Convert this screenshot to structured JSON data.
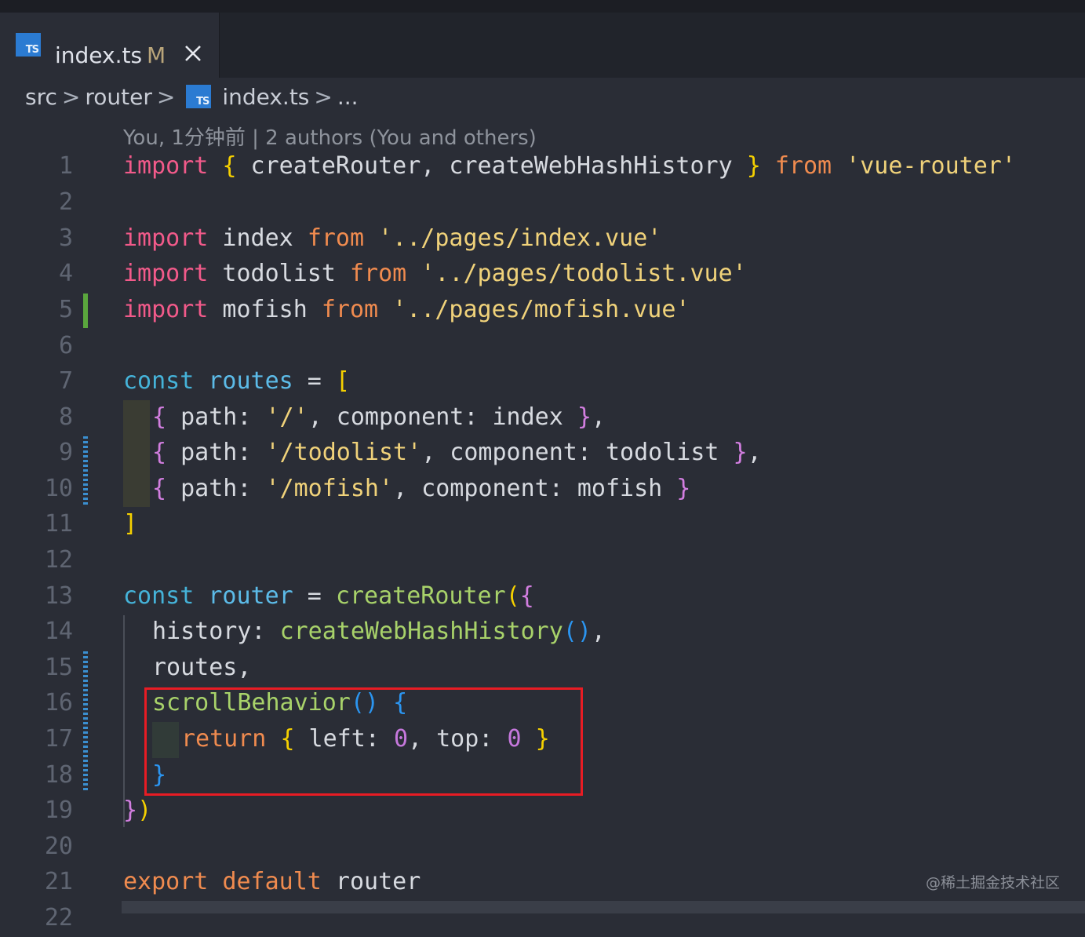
{
  "tab": {
    "icon_label": "TS",
    "title": "index.ts",
    "modified_badge": "M",
    "close_icon": "close-icon"
  },
  "breadcrumb": {
    "items": [
      "src",
      "router",
      "index.ts",
      "..."
    ],
    "separator": ">"
  },
  "blame": "You, 1分钟前 | 2 authors (You and others)",
  "line_numbers": [
    "1",
    "2",
    "3",
    "4",
    "5",
    "6",
    "7",
    "8",
    "9",
    "10",
    "11",
    "12",
    "13",
    "14",
    "15",
    "16",
    "17",
    "18",
    "19",
    "20",
    "21",
    "22"
  ],
  "code": {
    "l1": [
      "import",
      " ",
      "{",
      " createRouter, createWebHashHistory ",
      "}",
      " ",
      "from",
      " ",
      "'vue-router'"
    ],
    "l3": [
      "import",
      " index ",
      "from",
      " ",
      "'../pages/index.vue'"
    ],
    "l4": [
      "import",
      " todolist ",
      "from",
      " ",
      "'../pages/todolist.vue'"
    ],
    "l5": [
      "import",
      " mofish ",
      "from",
      " ",
      "'../pages/mofish.vue'"
    ],
    "l7": [
      "const",
      " ",
      "routes",
      " = ",
      "["
    ],
    "l8": [
      "{",
      " path: ",
      "'/'",
      ", component: index ",
      "}",
      ","
    ],
    "l9": [
      "{",
      " path: ",
      "'/todolist'",
      ", component: todolist ",
      "}",
      ","
    ],
    "l10": [
      "{",
      " path: ",
      "'/mofish'",
      ", component: mofish ",
      "}"
    ],
    "l11": [
      "]"
    ],
    "l13": [
      "const",
      " ",
      "router",
      " = ",
      "createRouter",
      "(",
      "{"
    ],
    "l14": [
      "history: ",
      "createWebHashHistory",
      "()",
      ","
    ],
    "l15": [
      "routes,"
    ],
    "l16": [
      "scrollBehavior",
      "()",
      " ",
      "{"
    ],
    "l17": [
      "return",
      " ",
      "{",
      " left: ",
      "0",
      ", top: ",
      "0",
      " ",
      "}"
    ],
    "l18": [
      "}"
    ],
    "l19": [
      "}",
      ")"
    ],
    "l21": [
      "export",
      " ",
      "default",
      " router"
    ]
  },
  "colors": {
    "background": "#2a2d36",
    "keyword_import": "#f25a8a",
    "keyword_from": "#f08b4f",
    "keyword_const": "#45b3d9",
    "string": "#f0d27a",
    "function": "#a8d26a",
    "number": "#c678dd",
    "highlight_box": "#e81c24",
    "git_added": "#5aa63d",
    "git_modified": "#3b8fd0"
  },
  "watermark": "@稀土掘金技术社区"
}
